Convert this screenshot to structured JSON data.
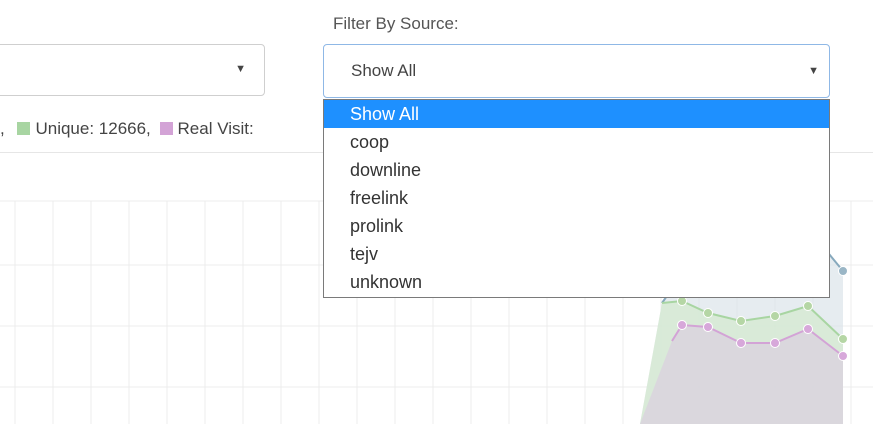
{
  "filter": {
    "label": "Filter By Source:",
    "selected": "Show All",
    "options": [
      "Show All",
      "coop",
      "downline",
      "freelink",
      "prolink",
      "tejv",
      "unknown"
    ]
  },
  "legend": {
    "prefix": ",",
    "unique": "Unique: 12666,",
    "real_visit": "Real Visit:"
  },
  "colors": {
    "accent": "#1e90ff",
    "unique": "#a8d5a2",
    "real_visit": "#d3a3d6",
    "total_line": "#87a9bd"
  },
  "icons": {
    "dropdown_arrow": "chevron-down-icon"
  }
}
